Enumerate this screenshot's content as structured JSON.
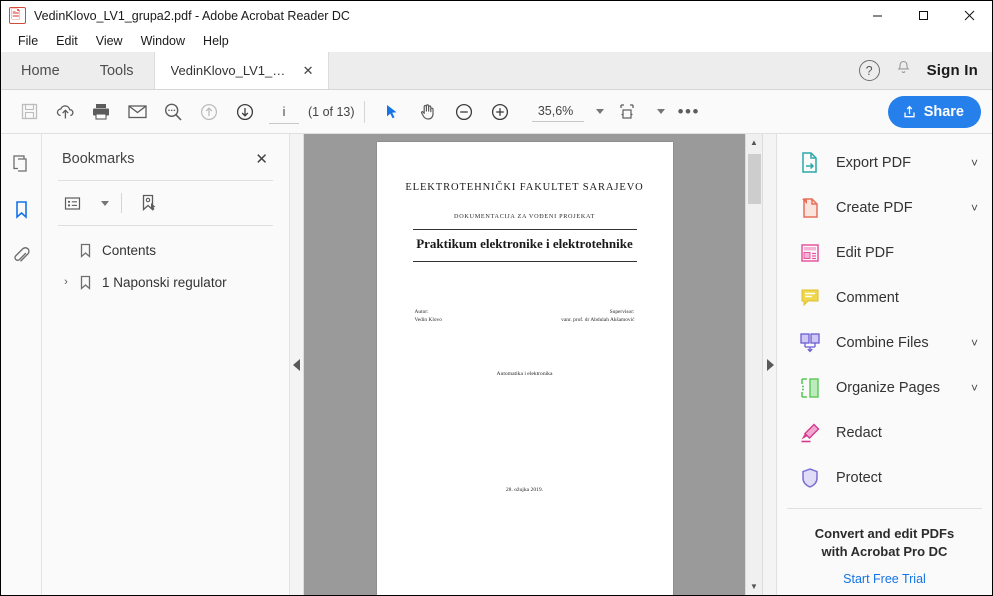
{
  "window": {
    "title": "VedinKlovo_LV1_grupa2.pdf - Adobe Acrobat Reader DC",
    "app_icon": "pdf-document-icon",
    "minimize": "—",
    "maximize": "☐",
    "close": "✕"
  },
  "menu": {
    "items": [
      "File",
      "Edit",
      "View",
      "Window",
      "Help"
    ]
  },
  "tabs": {
    "home": "Home",
    "tools": "Tools",
    "document": "VedinKlovo_LV1_gr...",
    "document_close": "✕",
    "help_icon_label": "?",
    "sign_in": "Sign In"
  },
  "toolbar": {
    "save": "save-icon",
    "upload_cloud": "upload-to-cloud-icon",
    "print": "print-icon",
    "email": "email-icon",
    "find": "find-text-icon",
    "previous_page": "previous-page-icon",
    "next_page": "next-page-icon",
    "page_number": "i",
    "page_count": "(1 of 13)",
    "select_tool": "select-cursor-icon",
    "hand_tool": "hand-pan-icon",
    "zoom_out": "zoom-out-icon",
    "zoom_in": "zoom-in-icon",
    "zoom_level": "35,6%",
    "zoom_dropdown_caret": "▾",
    "page_fit": "fit-page-width-icon",
    "more_tools": "•••",
    "share_label": "Share",
    "share_color": "#2680eb"
  },
  "rail": {
    "items": [
      {
        "name": "page-thumbnails",
        "icon": "pages-thumbnail-icon",
        "selected": false
      },
      {
        "name": "bookmarks",
        "icon": "bookmark-icon",
        "selected": true
      },
      {
        "name": "attachments",
        "icon": "paperclip-icon",
        "selected": false
      }
    ],
    "selected_color": "#1473e6"
  },
  "bookmarks": {
    "title": "Bookmarks",
    "close": "✕",
    "options_icon": "list-options-icon",
    "new_bookmark_icon": "new-bookmark-icon",
    "items": [
      {
        "label": "Contents",
        "expandable": false,
        "chevron": ""
      },
      {
        "label": "1 Naponski regulator",
        "expandable": true,
        "chevron": "›"
      }
    ]
  },
  "viewer": {
    "collapse_left": "◀",
    "collapse_right": "▶",
    "scroll_up": "▲",
    "scroll_down": "▼"
  },
  "document": {
    "faculty": "ELEKTROTEHNIČKI FAKULTET SARAJEVO",
    "subtitle": "DOKUMENTACIJA ZA VOĐENI PROJEKAT",
    "title": "Praktikum elektronike i elektrotehnike",
    "author_label": "Autor:",
    "author_name": "Vedin Klovo",
    "supervisor_label": "Supervisor:",
    "supervisor_name": "vanr. prof. dr Abdulah Akšamović",
    "department": "Automatika i elektronika",
    "date": "28. ožujka 2019."
  },
  "tools_panel": {
    "items": [
      {
        "label": "Export PDF",
        "icon": "export-pdf-icon",
        "color": "#2aa8a8",
        "chevron": "˅"
      },
      {
        "label": "Create PDF",
        "icon": "create-pdf-icon",
        "color": "#e8705a",
        "chevron": "˅"
      },
      {
        "label": "Edit PDF",
        "icon": "edit-pdf-icon",
        "color": "#e8559e",
        "chevron": ""
      },
      {
        "label": "Comment",
        "icon": "comment-icon",
        "color": "#e8cb33",
        "chevron": ""
      },
      {
        "label": "Combine Files",
        "icon": "combine-files-icon",
        "color": "#6b5fd4",
        "chevron": "˅"
      },
      {
        "label": "Organize Pages",
        "icon": "organize-pages-icon",
        "color": "#5ac85a",
        "chevron": "˅"
      },
      {
        "label": "Redact",
        "icon": "redact-icon",
        "color": "#d63a8f",
        "chevron": ""
      },
      {
        "label": "Protect",
        "icon": "protect-shield-icon",
        "color": "#7b6fd4",
        "chevron": ""
      }
    ],
    "promo_line1": "Convert and edit PDFs",
    "promo_line2": "with Acrobat Pro DC",
    "promo_link": "Start Free Trial",
    "promo_link_color": "#1473e6"
  }
}
